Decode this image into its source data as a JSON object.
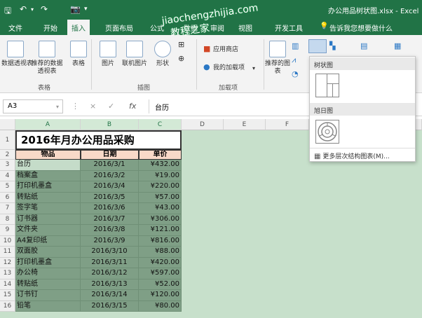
{
  "titlebar": {
    "title": "办公用品树状图.xlsx - Excel",
    "save_icon": "save-icon",
    "undo_icon": "undo-icon",
    "camera_icon": "camera-icon"
  },
  "tabs": {
    "file": "文件",
    "home": "开始",
    "insert": "插入",
    "layout": "页面布局",
    "formulas": "公式",
    "data": "数据",
    "review": "审阅",
    "view": "视图",
    "developer": "开发工具",
    "tellme": "告诉我您想要做什么"
  },
  "ribbon": {
    "pivot_table": "数据透视表",
    "recommended_pivot": "推荐的数据透视表",
    "table": "表格",
    "group_tables": "表格",
    "picture": "图片",
    "online_picture": "联机图片",
    "shapes": "形状",
    "group_illustrations": "插图",
    "store": "应用商店",
    "my_addins": "我的加载项",
    "group_addins": "加载项",
    "recommended_charts": "推荐的图表"
  },
  "formula_bar": {
    "name_box": "A3",
    "value": "台历",
    "cancel": "×",
    "enter": "✓",
    "fx": "fx"
  },
  "sheet": {
    "columns": [
      "A",
      "B",
      "C",
      "D",
      "E",
      "F"
    ],
    "title": "2016年月办公用品采购",
    "headers": [
      "物品",
      "日期",
      "单价"
    ],
    "rows": [
      [
        "台历",
        "2016/3/1",
        "¥432.00"
      ],
      [
        "档案盒",
        "2016/3/2",
        "¥19.00"
      ],
      [
        "打印机墨盒",
        "2016/3/4",
        "¥220.00"
      ],
      [
        "转贴纸",
        "2016/3/5",
        "¥57.00"
      ],
      [
        "签字笔",
        "2016/3/6",
        "¥43.00"
      ],
      [
        "订书器",
        "2016/3/7",
        "¥306.00"
      ],
      [
        "文件夹",
        "2016/3/8",
        "¥121.00"
      ],
      [
        "A4复印纸",
        "2016/3/9",
        "¥816.00"
      ],
      [
        "双面胶",
        "2016/3/10",
        "¥88.00"
      ],
      [
        "打印机墨盒",
        "2016/3/11",
        "¥420.00"
      ],
      [
        "办公椅",
        "2016/3/12",
        "¥597.00"
      ],
      [
        "转贴纸",
        "2016/3/13",
        "¥52.00"
      ],
      [
        "订书钉",
        "2016/3/14",
        "¥120.00"
      ],
      [
        "铅笔",
        "2016/3/15",
        "¥80.00"
      ]
    ]
  },
  "dropdown": {
    "treemap_header": "树状图",
    "sunburst_header": "旭日图",
    "more_charts": "更多层次结构图表(M)..."
  },
  "watermark": {
    "line1": "jiaochengzhijia.com",
    "line2": "教程之家"
  },
  "colors": {
    "excel_green": "#217346",
    "selection_fill": "#7f9f86",
    "title_border": "#333333",
    "header_fill": "#f8d9c8"
  }
}
